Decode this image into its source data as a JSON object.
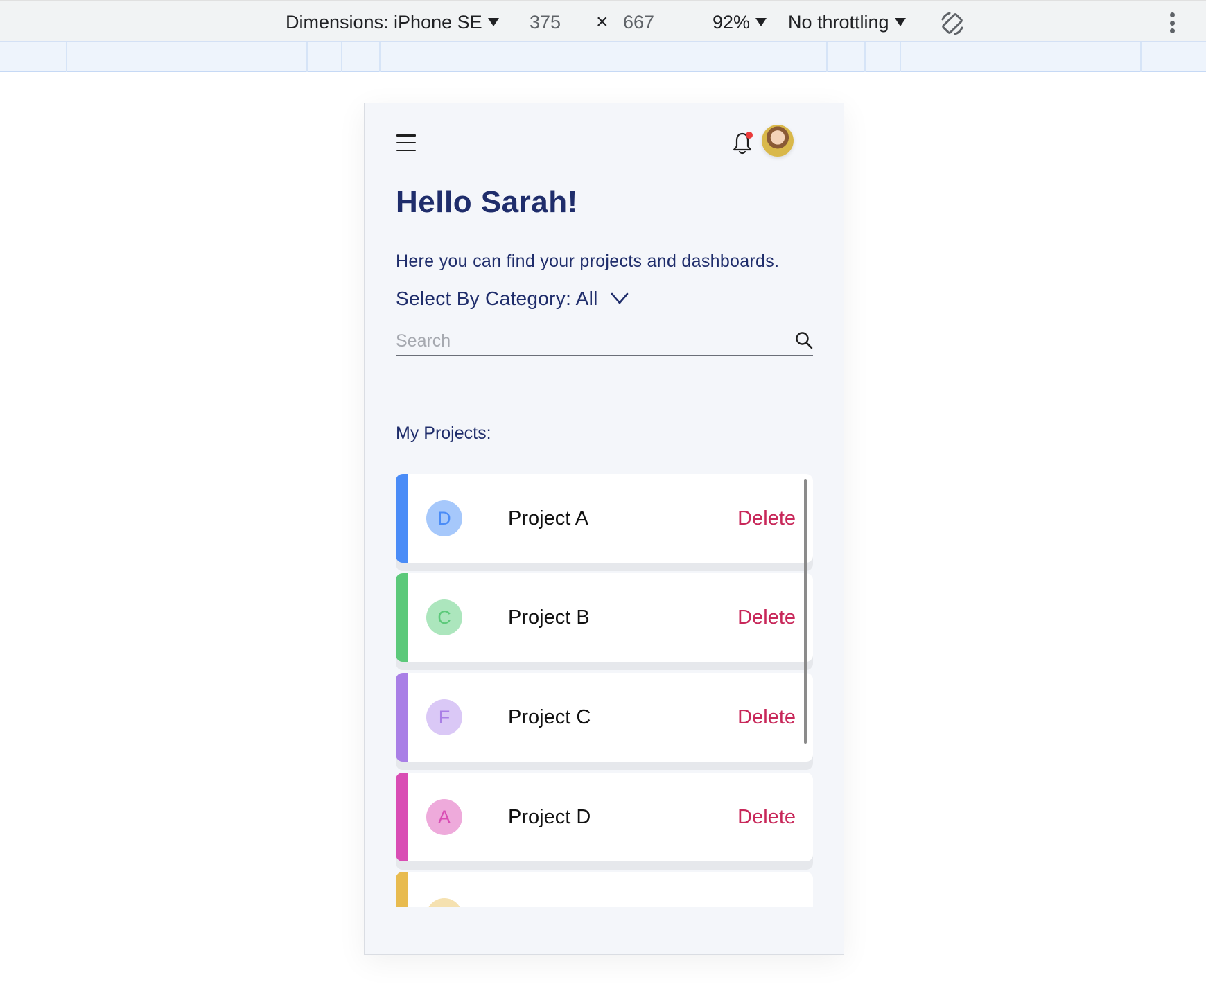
{
  "devtools": {
    "dimensions_label": "Dimensions: iPhone SE",
    "width": "375",
    "times": "×",
    "height": "667",
    "zoom": "92%",
    "throttling": "No throttling"
  },
  "app": {
    "greeting": "Hello Sarah!",
    "subtitle": "Here you can find your projects and dashboards.",
    "category_label": "Select By Category: All",
    "search_placeholder": "Search",
    "section_title": "My Projects:",
    "delete_label": "Delete",
    "projects": [
      {
        "name": "Project A",
        "initial": "D",
        "bar_color": "#4a8cf7",
        "circle_bg": "#a6c8fb",
        "circle_fg": "#4a8cf7"
      },
      {
        "name": "Project B",
        "initial": "C",
        "bar_color": "#5cc97a",
        "circle_bg": "#ace6bd",
        "circle_fg": "#5cc97a"
      },
      {
        "name": "Project C",
        "initial": "F",
        "bar_color": "#a97fe6",
        "circle_bg": "#dac8f6",
        "circle_fg": "#a97fe6"
      },
      {
        "name": "Project D",
        "initial": "A",
        "bar_color": "#d94db4",
        "circle_bg": "#eeaadb",
        "circle_fg": "#d94db4"
      },
      {
        "name": "",
        "initial": "",
        "bar_color": "#e8bb4f",
        "circle_bg": "#f5e1b0",
        "circle_fg": "#e8bb4f"
      }
    ]
  }
}
